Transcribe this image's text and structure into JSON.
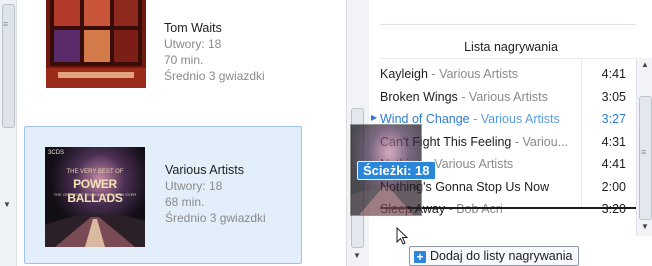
{
  "albums": [
    {
      "artist": "Tom Waits",
      "tracks": "Utwory: 18",
      "length": "70 min.",
      "rating": "Średnio 3 gwiazdki",
      "selected": false
    },
    {
      "artist": "Various Artists",
      "tracks": "Utwory: 18",
      "length": "68 min.",
      "rating": "Średnio 3 gwiazdki",
      "selected": true,
      "cover_text": {
        "label": "3CDS",
        "line1": "THE VERY BEST OF",
        "line2": "POWER BALLADS",
        "line3": "THE GREATEST ROCKING ANTHEMS EVER"
      }
    }
  ],
  "playlist": {
    "title": "Lista nagrywania",
    "separator": " - ",
    "items": [
      {
        "title": "Kayleigh",
        "artist": "Various Artists",
        "duration": "4:41",
        "playing": false
      },
      {
        "title": "Broken Wings",
        "artist": "Various Artists",
        "duration": "3:05",
        "playing": false
      },
      {
        "title": "Wind of Change",
        "artist": "Various Artists",
        "duration": "3:27",
        "playing": true
      },
      {
        "title": "Can't Fight This Feeling",
        "artist": "Variou...",
        "duration": "4:31",
        "playing": false
      },
      {
        "title": "Nothing",
        "artist": "Various Artists",
        "duration": "4:41",
        "playing": false
      },
      {
        "title": "Nothing's Gonna Stop Us Now",
        "artist": "",
        "duration": "2:00",
        "playing": false
      },
      {
        "title": "Sleep Away",
        "artist": "Bob Acri",
        "duration": "3:20",
        "playing": false
      }
    ]
  },
  "drag": {
    "badge": "Ścieżki: 18",
    "tooltip": "Dodaj do listy nagrywania"
  },
  "colors": {
    "selection_bg": "#e3eefb",
    "selection_border": "#9ec2e8",
    "playing": "#2f7bd6",
    "badge": "#2a86d9"
  },
  "icons": [
    "play-indicator-icon",
    "plus-icon",
    "mouse-cursor-icon",
    "scroll-up-arrow-icon",
    "scroll-down-arrow-icon"
  ]
}
